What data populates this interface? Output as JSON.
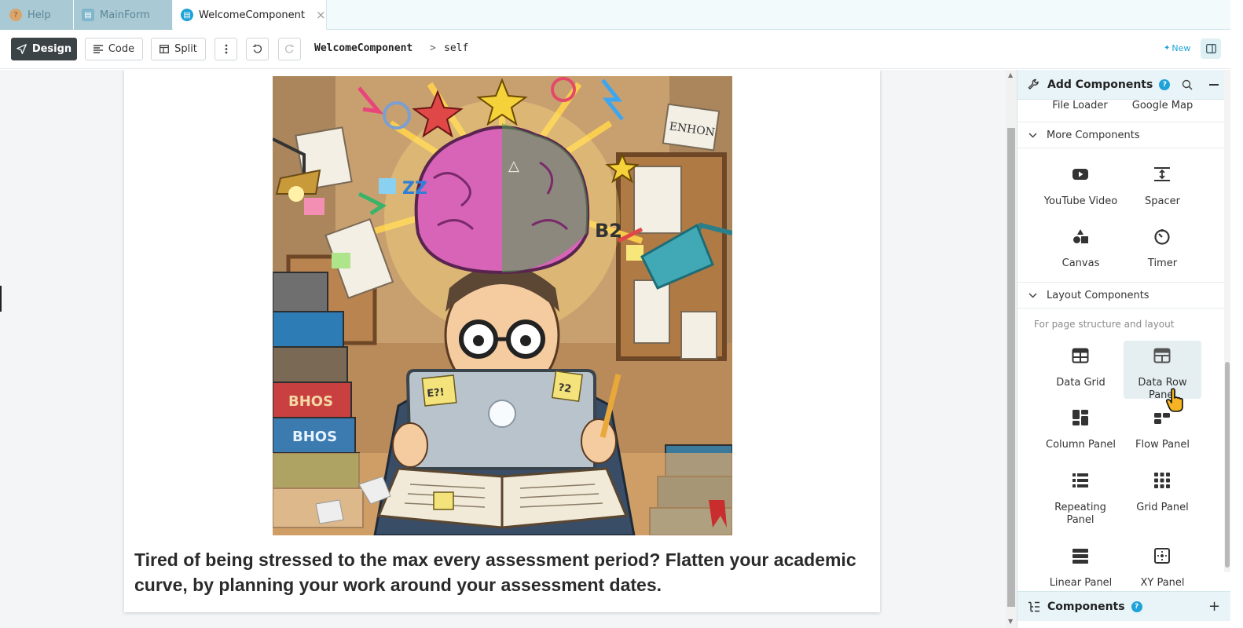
{
  "tabs": [
    {
      "label": "Help",
      "icon": "help-doc-icon",
      "state": "inactive"
    },
    {
      "label": "MainForm",
      "icon": "form-icon",
      "state": "inactive"
    },
    {
      "label": "WelcomeComponent",
      "icon": "component-icon",
      "state": "active",
      "close": "×"
    }
  ],
  "toolbar": {
    "design_label": "Design",
    "code_label": "Code",
    "split_label": "Split",
    "breadcrumb_component": "WelcomeComponent",
    "breadcrumb_separator": ">",
    "breadcrumb_self": "self",
    "new_label": "New"
  },
  "canvas": {
    "caption": "Tired of being stressed to the max every assessment period? Flatten your academic curve, by planning your work around your assessment dates.",
    "illustration_text": {
      "note_top_right": "ENHON",
      "sticky_left": "E?!",
      "sticky_right": "?2",
      "badge": "B2",
      "book_1": "BHOS",
      "book_2": "BHOS",
      "zz": "ZZ"
    }
  },
  "panel": {
    "title": "Add Components",
    "help": "?",
    "partial_items": [
      "File Loader",
      "Google Map"
    ],
    "sections": [
      {
        "title": "More Components",
        "items": [
          {
            "label": "YouTube Video",
            "icon": "youtube-icon"
          },
          {
            "label": "Spacer",
            "icon": "spacer-icon"
          },
          {
            "label": "Canvas",
            "icon": "canvas-shapes-icon"
          },
          {
            "label": "Timer",
            "icon": "timer-icon"
          }
        ]
      },
      {
        "title": "Layout Components",
        "description": "For page structure and layout",
        "items": [
          {
            "label": "Data Grid",
            "icon": "data-grid-icon"
          },
          {
            "label": "Data Row Panel",
            "icon": "data-row-panel-icon",
            "hovered": true
          },
          {
            "label": "Column Panel",
            "icon": "column-panel-icon"
          },
          {
            "label": "Flow Panel",
            "icon": "flow-panel-icon"
          },
          {
            "label": "Repeating Panel",
            "icon": "repeating-panel-icon"
          },
          {
            "label": "Grid Panel",
            "icon": "grid-panel-icon"
          },
          {
            "label": "Linear Panel",
            "icon": "linear-panel-icon"
          },
          {
            "label": "XY Panel",
            "icon": "xy-panel-icon"
          }
        ]
      }
    ],
    "footer_title": "Components",
    "footer_help": "?"
  },
  "colors": {
    "accent": "#1fa2d8",
    "primary_button": "#3c4347",
    "panel_header": "#e8f4f7",
    "inactive_tab": "#a9c9d4"
  }
}
